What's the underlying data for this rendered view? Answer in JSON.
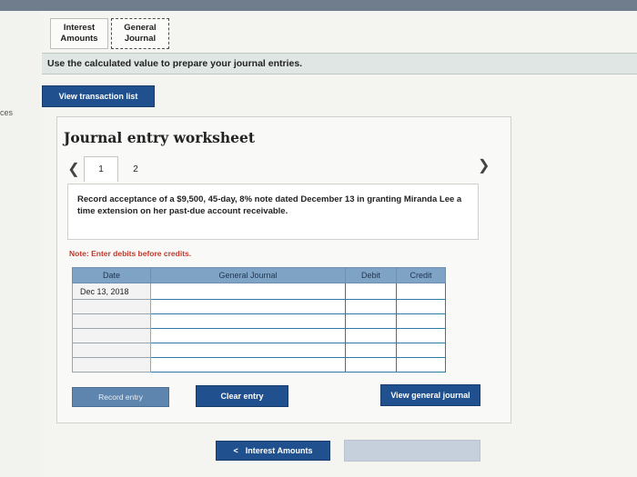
{
  "sidebar": {
    "partial_text": "ces"
  },
  "tabs": [
    {
      "label": "Interest\nAmounts",
      "active": false
    },
    {
      "label": "General\nJournal",
      "active": true
    }
  ],
  "instruction": "Use the calculated value to prepare your journal entries.",
  "buttons": {
    "view_transaction_list": "View transaction list",
    "record_entry": "Record entry",
    "clear_entry": "Clear entry",
    "view_general_journal": "View general journal",
    "prev": "Interest Amounts"
  },
  "icons": {
    "prev": "chevron-left-icon",
    "next": "chevron-right-icon"
  },
  "worksheet": {
    "title": "Journal entry worksheet",
    "pages": [
      "1",
      "2"
    ],
    "current_page": "1",
    "question": "Record acceptance of a $9,500, 45-day, 8% note dated December 13 in granting Miranda Lee a time extension on her past-due account receivable.",
    "note": "Note: Enter debits before credits."
  },
  "table": {
    "headers": {
      "date": "Date",
      "journal": "General Journal",
      "debit": "Debit",
      "credit": "Credit"
    },
    "rows": [
      {
        "date": "Dec 13, 2018",
        "account": "",
        "debit": "",
        "credit": ""
      },
      {
        "date": "",
        "account": "",
        "debit": "",
        "credit": ""
      },
      {
        "date": "",
        "account": "",
        "debit": "",
        "credit": ""
      },
      {
        "date": "",
        "account": "",
        "debit": "",
        "credit": ""
      },
      {
        "date": "",
        "account": "",
        "debit": "",
        "credit": ""
      },
      {
        "date": "",
        "account": "",
        "debit": "",
        "credit": ""
      }
    ]
  },
  "colors": {
    "primary": "#20508d",
    "table_header": "#7fa3c4",
    "note": "#c0392b"
  }
}
